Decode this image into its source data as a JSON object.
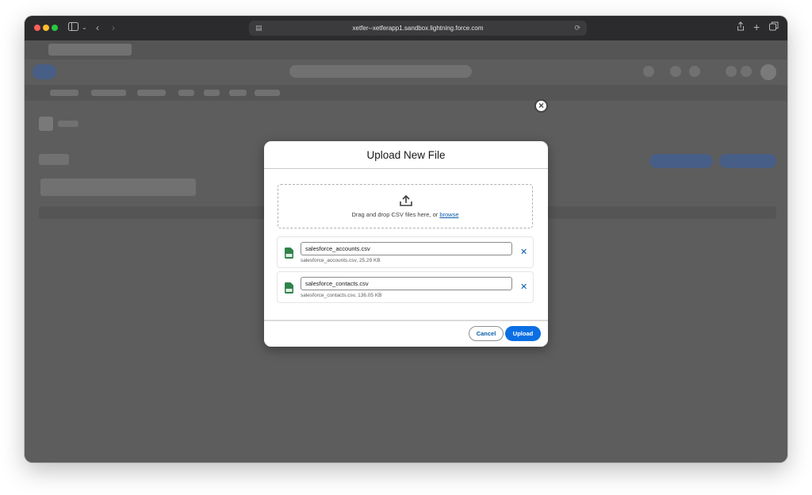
{
  "browser": {
    "url": "xetfer--xetferapp1.sandbox.lightning.force.com"
  },
  "modal": {
    "title": "Upload New File",
    "dropzone_text": "Drag and drop CSV files here, or ",
    "browse_label": "browse",
    "files": [
      {
        "name": "salesforce_accounts.csv",
        "meta": "salesforce_accounts.csv, 25.29 KB"
      },
      {
        "name": "salesforce_contacts.csv",
        "meta": "salesforce_contacts.csv, 136.05 KB"
      }
    ],
    "cancel_label": "Cancel",
    "upload_label": "Upload"
  },
  "colors": {
    "brand_blue": "#0b6fe4",
    "link_blue": "#0b5cab",
    "csv_green": "#2e844a"
  },
  "icons": {
    "close": "close-circle-icon",
    "upload": "upload-icon",
    "file": "csv-file-icon",
    "remove": "remove-x-icon"
  }
}
